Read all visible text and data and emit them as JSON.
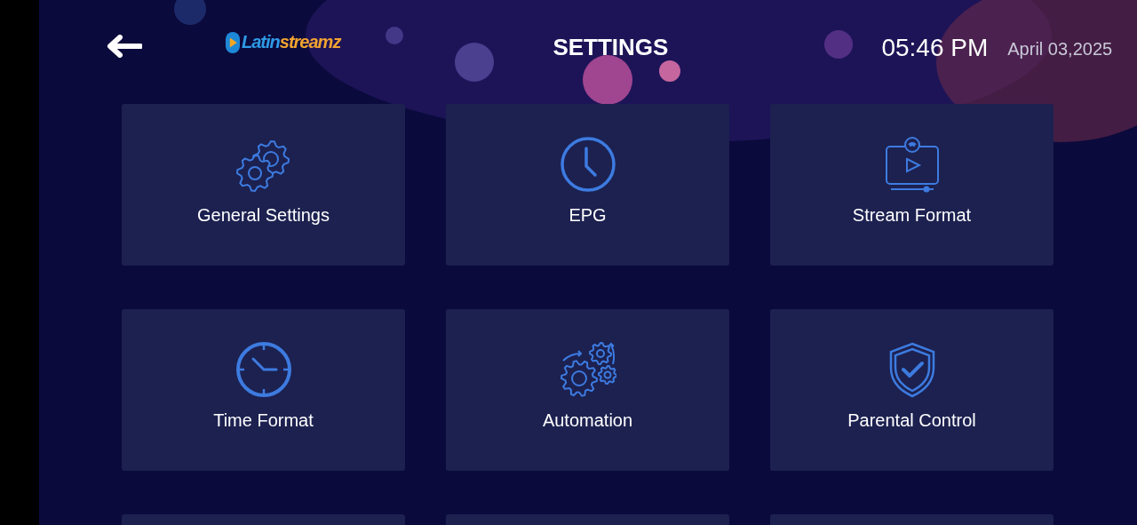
{
  "header": {
    "logo": {
      "parts": [
        "Latin",
        "streamz"
      ]
    },
    "title": "SETTINGS",
    "time": "05:46 PM",
    "date": "April 03,2025"
  },
  "tiles": [
    {
      "kind": "full",
      "label": "General Settings"
    },
    {
      "kind": "full",
      "label": "EPG"
    },
    {
      "kind": "full",
      "label": "Stream Format"
    },
    {
      "kind": "full",
      "label": "Time Format"
    },
    {
      "kind": "full",
      "label": "Automation"
    },
    {
      "kind": "full",
      "label": "Parental Control"
    },
    {
      "kind": "partial"
    },
    {
      "kind": "partial"
    },
    {
      "kind": "partial"
    }
  ]
}
